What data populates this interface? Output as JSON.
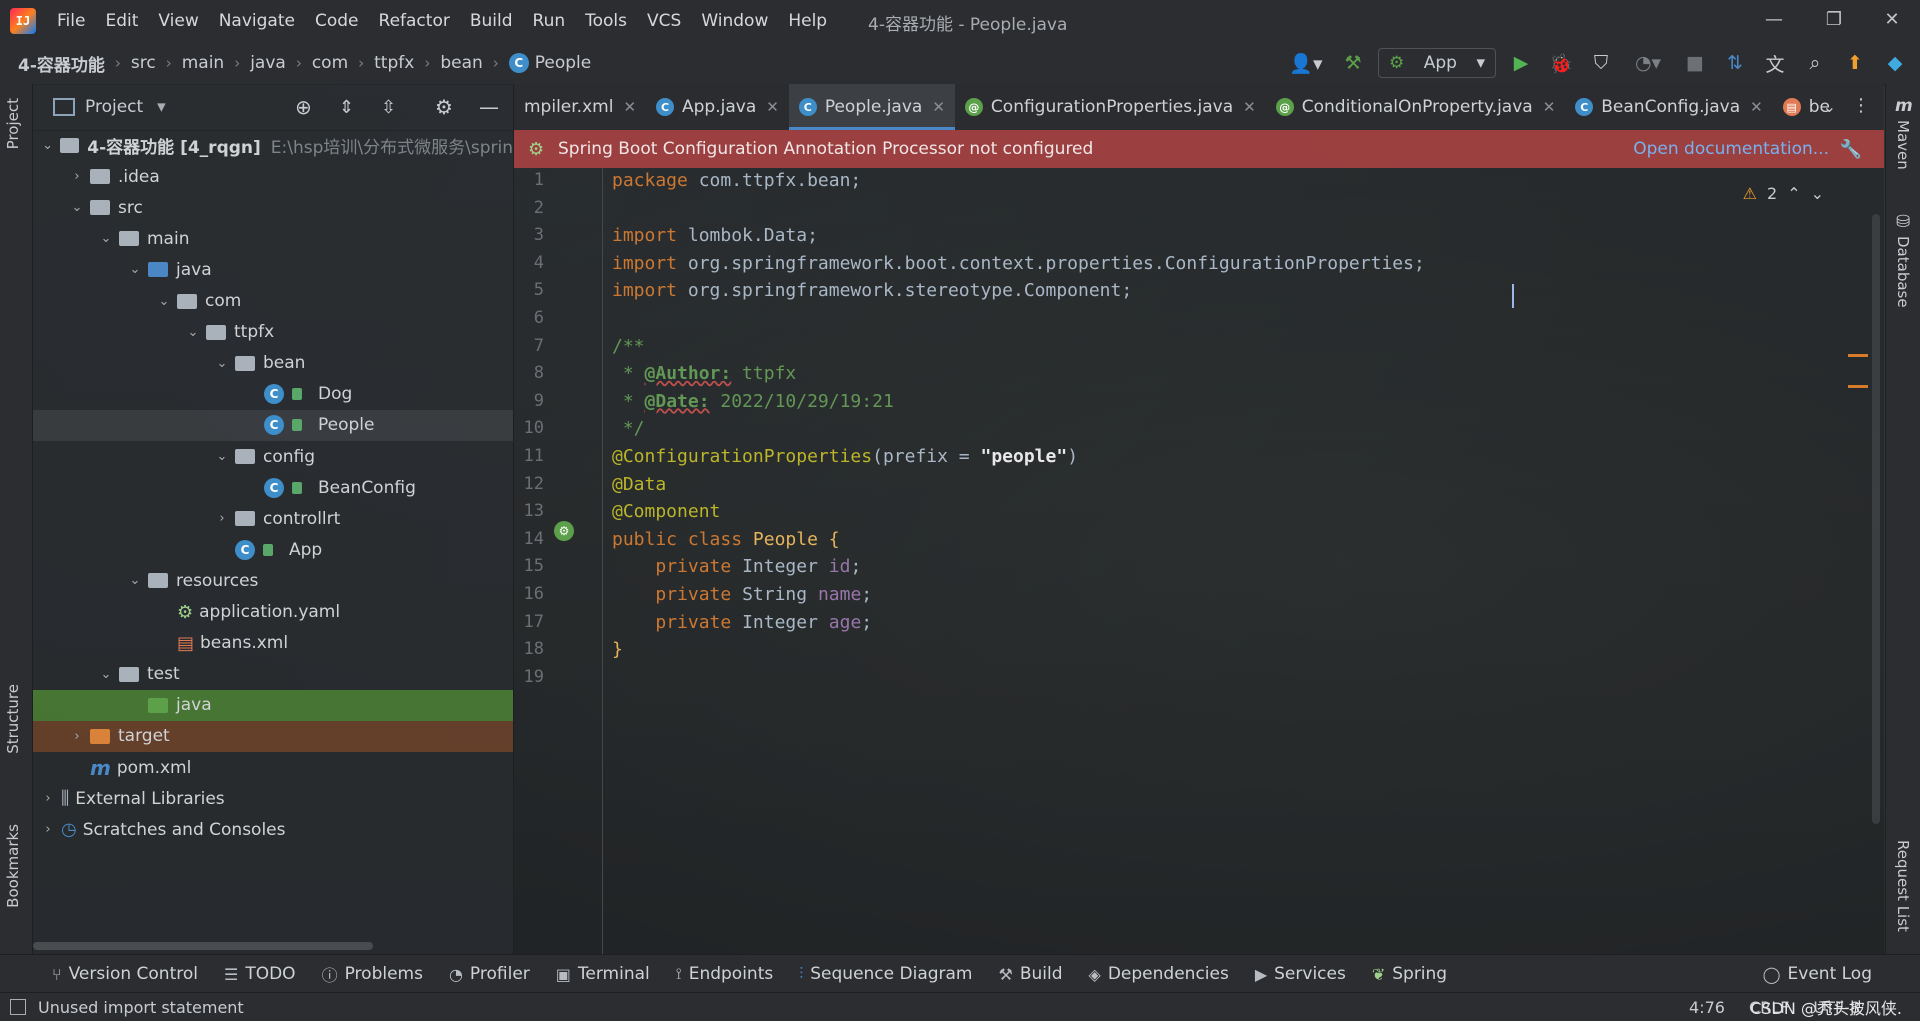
{
  "window": {
    "title": "4-容器功能 - People.java",
    "menu": [
      "File",
      "Edit",
      "View",
      "Navigate",
      "Code",
      "Refactor",
      "Build",
      "Run",
      "Tools",
      "VCS",
      "Window",
      "Help"
    ],
    "logo_text": "IJ"
  },
  "breadcrumb": [
    "4-容器功能",
    "src",
    "main",
    "java",
    "com",
    "ttpfx",
    "bean",
    "People"
  ],
  "run_config": "App",
  "project_panel": {
    "title": "Project",
    "root_label": "4-容器功能 [4_rqgn]",
    "root_path": "E:\\hsp培训\\分布式微服务\\sprin",
    "tree": [
      {
        "label": ".idea",
        "depth": 1,
        "kind": "folder",
        "arrow": "›"
      },
      {
        "label": "src",
        "depth": 1,
        "kind": "folder",
        "arrow": "⌄"
      },
      {
        "label": "main",
        "depth": 2,
        "kind": "folder",
        "arrow": "⌄"
      },
      {
        "label": "java",
        "depth": 3,
        "kind": "folder-blue",
        "arrow": "⌄"
      },
      {
        "label": "com",
        "depth": 4,
        "kind": "folder",
        "arrow": "⌄"
      },
      {
        "label": "ttpfx",
        "depth": 5,
        "kind": "folder",
        "arrow": "⌄"
      },
      {
        "label": "bean",
        "depth": 6,
        "kind": "folder",
        "arrow": "⌄"
      },
      {
        "label": "Dog",
        "depth": 7,
        "kind": "class",
        "arrow": ""
      },
      {
        "label": "People",
        "depth": 7,
        "kind": "class",
        "arrow": ""
      },
      {
        "label": "config",
        "depth": 6,
        "kind": "folder",
        "arrow": "⌄"
      },
      {
        "label": "BeanConfig",
        "depth": 7,
        "kind": "class",
        "arrow": ""
      },
      {
        "label": "controllrt",
        "depth": 6,
        "kind": "folder",
        "arrow": "›"
      },
      {
        "label": "App",
        "depth": 6,
        "kind": "app",
        "arrow": ""
      },
      {
        "label": "resources",
        "depth": 3,
        "kind": "folder-res",
        "arrow": "⌄"
      },
      {
        "label": "application.yaml",
        "depth": 4,
        "kind": "yaml",
        "arrow": ""
      },
      {
        "label": "beans.xml",
        "depth": 4,
        "kind": "xml",
        "arrow": ""
      },
      {
        "label": "test",
        "depth": 2,
        "kind": "folder",
        "arrow": "⌄"
      },
      {
        "label": "java",
        "depth": 3,
        "kind": "folder-green",
        "arrow": ""
      },
      {
        "label": "target",
        "depth": 1,
        "kind": "folder-orange",
        "arrow": "›"
      },
      {
        "label": "pom.xml",
        "depth": 1,
        "kind": "maven",
        "arrow": ""
      },
      {
        "label": "External Libraries",
        "depth": 0,
        "kind": "lib",
        "arrow": "›"
      },
      {
        "label": "Scratches and Consoles",
        "depth": 0,
        "kind": "scratch",
        "arrow": "›"
      }
    ]
  },
  "tabs": [
    {
      "label": "mpiler.xml",
      "icon": "xml"
    },
    {
      "label": "App.java",
      "icon": "app"
    },
    {
      "label": "People.java",
      "icon": "class",
      "active": true
    },
    {
      "label": "ConfigurationProperties.java",
      "icon": "annotation"
    },
    {
      "label": "ConditionalOnProperty.java",
      "icon": "annotation"
    },
    {
      "label": "BeanConfig.java",
      "icon": "class"
    },
    {
      "label": "be",
      "icon": "xml"
    }
  ],
  "banner": {
    "text": "Spring Boot Configuration Annotation Processor not configured",
    "link": "Open documentation..."
  },
  "inspection": {
    "warnings": "2"
  },
  "code_lines": [
    "package com.ttpfx.bean;",
    "",
    "import lombok.Data;",
    "import org.springframework.boot.context.properties.ConfigurationProperties;",
    "import org.springframework.stereotype.Component;",
    "",
    "/**",
    " * @Author: ttpfx",
    " * @Date: 2022/10/29/19:21",
    " */",
    "@ConfigurationProperties(prefix = \"people\")",
    "@Data",
    "@Component",
    "public class People {",
    "    private Integer id;",
    "    private String name;",
    "    private Integer age;",
    "}",
    ""
  ],
  "line_numbers": [
    "1",
    "2",
    "3",
    "4",
    "5",
    "6",
    "7",
    "8",
    "9",
    "10",
    "11",
    "12",
    "13",
    "14",
    "15",
    "16",
    "17",
    "18",
    "19"
  ],
  "left_stripe": {
    "top": "Project",
    "structure": "Structure",
    "bookmarks": "Bookmarks"
  },
  "right_stripe": {
    "maven": "Maven",
    "database": "Database",
    "request": "Request List"
  },
  "bottom_tools": [
    "Version Control",
    "TODO",
    "Problems",
    "Profiler",
    "Terminal",
    "Endpoints",
    "Sequence Diagram",
    "Build",
    "Dependencies",
    "Services",
    "Spring"
  ],
  "event_log": "Event Log",
  "status": {
    "message": "Unused import statement",
    "position": "4:76",
    "line_sep": "CRLF",
    "encoding": "UTF-8",
    "watermark": "CSDN @秃头披风侠."
  },
  "colors": {
    "accent": "#4a88c7",
    "banner": "#b04343",
    "keyword": "#cc7832",
    "annotation": "#bbb529",
    "comment": "#629755",
    "field": "#9876aa"
  }
}
